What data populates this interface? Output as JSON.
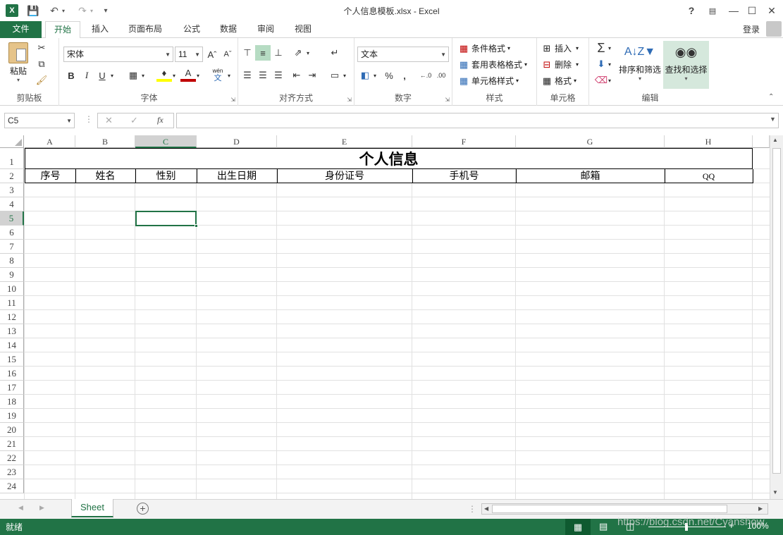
{
  "window": {
    "title": "个人信息模板.xlsx - Excel",
    "help": "?",
    "signin": "登录"
  },
  "tabs": [
    "文件",
    "开始",
    "插入",
    "页面布局",
    "公式",
    "数据",
    "审阅",
    "视图"
  ],
  "ribbon": {
    "clipboard": {
      "paste": "粘贴",
      "label": "剪贴板"
    },
    "font": {
      "name": "宋体",
      "size": "11",
      "label": "字体",
      "bold": "B",
      "italic": "I",
      "underline": "U",
      "phonetic_top": "wén",
      "phonetic_bottom": "文"
    },
    "alignment": {
      "label": "对齐方式"
    },
    "number": {
      "format": "文本",
      "percent": "%",
      "comma": ",",
      "label": "数字"
    },
    "styles": {
      "conditional": "条件格式",
      "table": "套用表格格式",
      "cell": "单元格样式",
      "label": "样式"
    },
    "cells": {
      "insert": "插入",
      "delete": "删除",
      "format": "格式",
      "label": "单元格"
    },
    "editing": {
      "sort": "排序和筛选",
      "find": "查找和选择",
      "label": "编辑"
    }
  },
  "formula_bar": {
    "name_box": "C5",
    "fx": "fx",
    "value": ""
  },
  "columns": [
    "A",
    "B",
    "C",
    "D",
    "E",
    "F",
    "G",
    "H"
  ],
  "rows": [
    "1",
    "2",
    "3",
    "4",
    "5",
    "6",
    "7",
    "8",
    "9",
    "10",
    "11",
    "12",
    "13",
    "14",
    "15",
    "16",
    "17",
    "18",
    "19",
    "20",
    "21",
    "22",
    "23",
    "24"
  ],
  "selected_cell": {
    "column": "C",
    "row": "5"
  },
  "sheet": {
    "title": "个人信息",
    "headers": [
      "序号",
      "姓名",
      "性别",
      "出生日期",
      "身份证号",
      "手机号",
      "邮箱",
      "QQ"
    ]
  },
  "sheet_tabs": [
    "Sheet"
  ],
  "status": {
    "ready": "就绪",
    "zoom": "100%",
    "watermark": "https://blog.csdn.net/Cyanshow"
  },
  "colors": {
    "accent": "#217346"
  }
}
